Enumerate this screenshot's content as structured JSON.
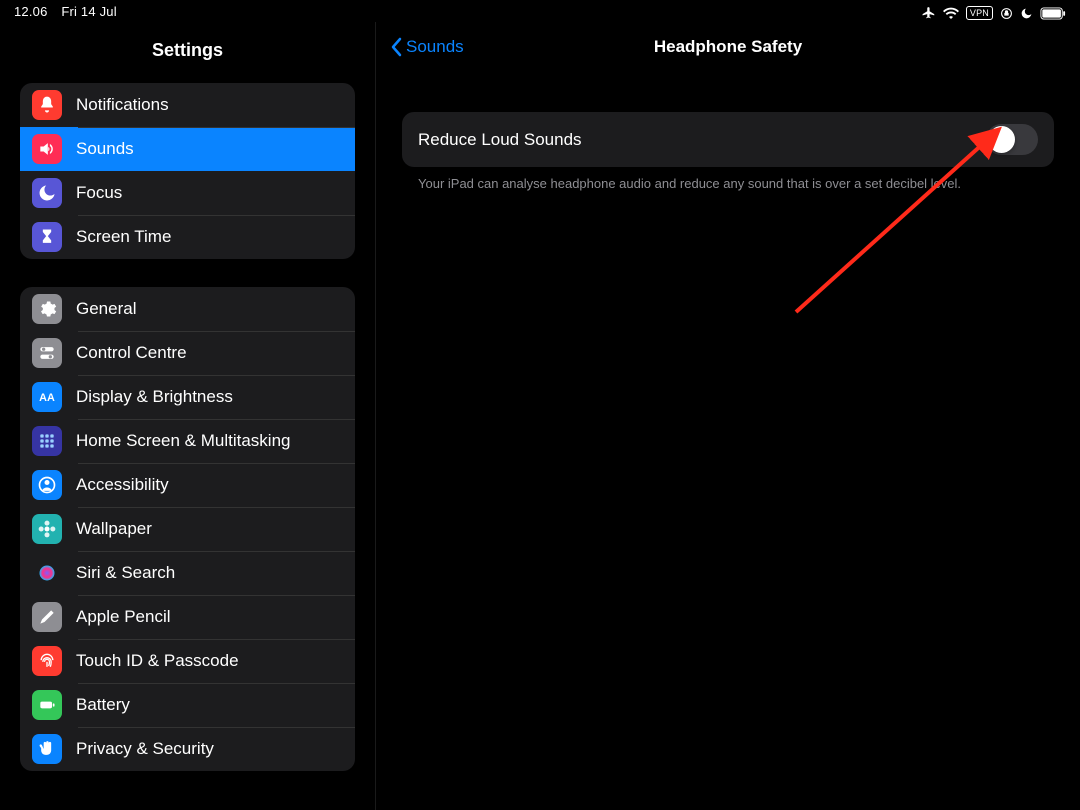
{
  "status": {
    "time": "12.06",
    "date": "Fri 14 Jul",
    "vpn": "VPN"
  },
  "sidebar": {
    "title": "Settings",
    "group1": [
      {
        "label": "Notifications",
        "icon": "bell",
        "bg": "#ff3b30"
      },
      {
        "label": "Sounds",
        "icon": "speaker",
        "bg": "#ff2d55",
        "selected": true
      },
      {
        "label": "Focus",
        "icon": "moon",
        "bg": "#5856d6"
      },
      {
        "label": "Screen Time",
        "icon": "hourglass",
        "bg": "#5856d6"
      }
    ],
    "group2": [
      {
        "label": "General",
        "icon": "gear",
        "bg": "#8e8e93"
      },
      {
        "label": "Control Centre",
        "icon": "switches",
        "bg": "#8e8e93"
      },
      {
        "label": "Display & Brightness",
        "icon": "aa",
        "bg": "#0a84ff"
      },
      {
        "label": "Home Screen & Multitasking",
        "icon": "grid",
        "bg": "#3634a3"
      },
      {
        "label": "Accessibility",
        "icon": "person",
        "bg": "#0a84ff"
      },
      {
        "label": "Wallpaper",
        "icon": "flower",
        "bg": "#22b2b0"
      },
      {
        "label": "Siri & Search",
        "icon": "siri",
        "bg": "#1c1c1e"
      },
      {
        "label": "Apple Pencil",
        "icon": "pencil",
        "bg": "#8e8e93"
      },
      {
        "label": "Touch ID & Passcode",
        "icon": "fingerprint",
        "bg": "#ff3b30"
      },
      {
        "label": "Battery",
        "icon": "battery",
        "bg": "#34c759"
      },
      {
        "label": "Privacy & Security",
        "icon": "hand",
        "bg": "#0a84ff"
      }
    ]
  },
  "detail": {
    "back": "Sounds",
    "title": "Headphone Safety",
    "cell_label": "Reduce Loud Sounds",
    "footnote": "Your iPad can analyse headphone audio and reduce any sound that is over a set decibel level."
  }
}
